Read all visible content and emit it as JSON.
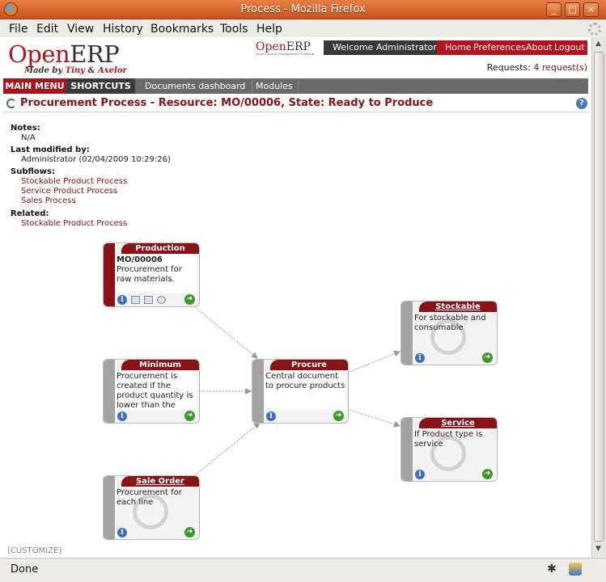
{
  "window": {
    "title": "Process - Mozilla Firefox",
    "buttons": [
      "_",
      "□",
      "×"
    ]
  },
  "menubar": [
    "File",
    "Edit",
    "View",
    "History",
    "Bookmarks",
    "Tools",
    "Help"
  ],
  "header": {
    "logo_open": "Open",
    "logo_erp": "ERP",
    "logo_tagline_prefix": "Made by ",
    "logo_tagline_tiny": "Tiny",
    "logo_tagline_amp": " & ",
    "logo_tagline_axelor": "Axelor",
    "mini_logo_open": "Open",
    "mini_logo_erp": "ERP",
    "mini_logo_sub": "Open Source Management Solution",
    "welcome": "Welcome Administrator",
    "links": [
      "Home",
      "Preferences",
      "About",
      "Logout"
    ],
    "requests_label": "Requests:",
    "requests_link": "4 request(s)"
  },
  "nav": {
    "main_menu": "MAIN MENU",
    "shortcuts": "SHORTCUTS",
    "items": [
      "Documents dashboard",
      "Modules"
    ]
  },
  "page_title": "Procurement Process - Resource: MO/00006, State: Ready to Produce",
  "info": {
    "notes_label": "Notes:",
    "notes_value": "N/A",
    "modified_label": "Last modified by:",
    "modified_value": "Administrator (02/04/2009 10:29:26)",
    "subflows_label": "Subflows:",
    "subflows": [
      "Stockable Product Process",
      "Service Product Process",
      "Sales Process"
    ],
    "related_label": "Related:",
    "related": [
      "Stockable Product Process"
    ]
  },
  "nodes": {
    "production": {
      "title": "Production",
      "code": "MO/00006",
      "text": "Procurement for raw materials."
    },
    "minimum": {
      "title": "Minimum",
      "text": "Procurement is created if the product quantity is lower than the minimum limit."
    },
    "saleorder": {
      "title": "Sale Order",
      "text": "Procurement for each line"
    },
    "procure": {
      "title": "Procure",
      "text": "Central document to procure products"
    },
    "stockable": {
      "title": "Stockable",
      "text": "For stockable and consumable"
    },
    "service": {
      "title": "Service",
      "text": "If Product type is service"
    }
  },
  "icons": {
    "info": "i",
    "go": "➜"
  },
  "customize": "[CUSTOMIZE]",
  "statusbar": {
    "status": "Done",
    "bug_icon": "✱"
  },
  "colors": {
    "accent": "#8a1116",
    "brand_red": "#b4121c",
    "firefox_title": "#d4672c"
  }
}
